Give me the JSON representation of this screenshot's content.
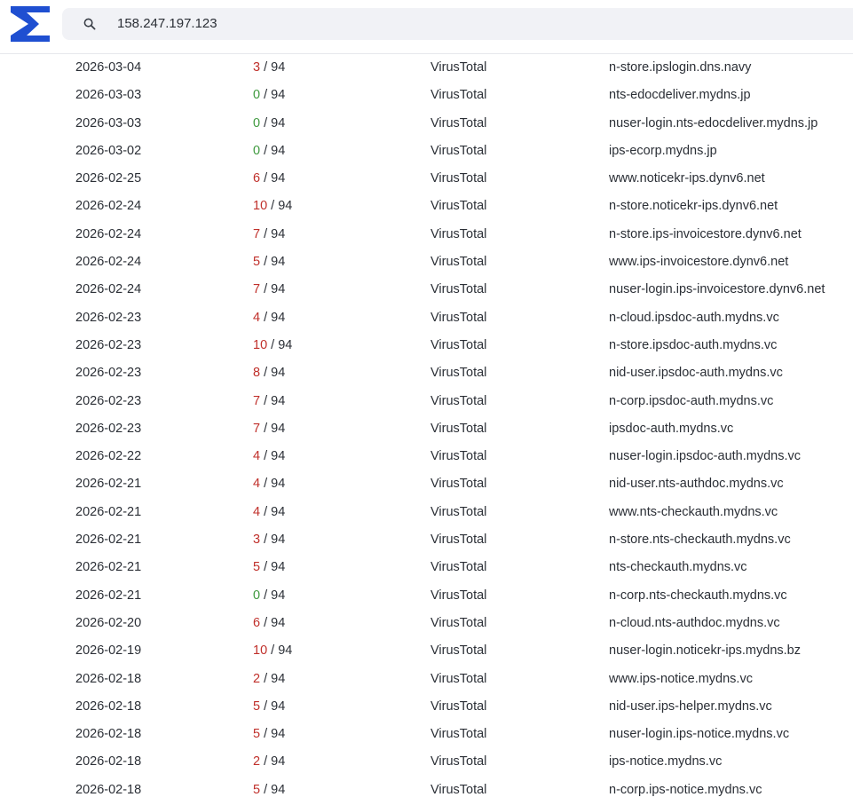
{
  "search": {
    "value": "158.247.197.123"
  },
  "colors": {
    "malicious": "#c0302b",
    "clean": "#3f9a3f",
    "logo": "#1f4fd1"
  },
  "rows": [
    {
      "date": "2026-03-04",
      "positives": "3",
      "total": "/ 94",
      "source": "VirusTotal",
      "domain": "n-store.ipslogin.dns.navy"
    },
    {
      "date": "2026-03-03",
      "positives": "0",
      "total": "/ 94",
      "source": "VirusTotal",
      "domain": "nts-edocdeliver.mydns.jp"
    },
    {
      "date": "2026-03-03",
      "positives": "0",
      "total": "/ 94",
      "source": "VirusTotal",
      "domain": "nuser-login.nts-edocdeliver.mydns.jp"
    },
    {
      "date": "2026-03-02",
      "positives": "0",
      "total": "/ 94",
      "source": "VirusTotal",
      "domain": "ips-ecorp.mydns.jp"
    },
    {
      "date": "2026-02-25",
      "positives": "6",
      "total": "/ 94",
      "source": "VirusTotal",
      "domain": "www.noticekr-ips.dynv6.net"
    },
    {
      "date": "2026-02-24",
      "positives": "10",
      "total": "/ 94",
      "source": "VirusTotal",
      "domain": "n-store.noticekr-ips.dynv6.net"
    },
    {
      "date": "2026-02-24",
      "positives": "7",
      "total": "/ 94",
      "source": "VirusTotal",
      "domain": "n-store.ips-invoicestore.dynv6.net"
    },
    {
      "date": "2026-02-24",
      "positives": "5",
      "total": "/ 94",
      "source": "VirusTotal",
      "domain": "www.ips-invoicestore.dynv6.net"
    },
    {
      "date": "2026-02-24",
      "positives": "7",
      "total": "/ 94",
      "source": "VirusTotal",
      "domain": "nuser-login.ips-invoicestore.dynv6.net"
    },
    {
      "date": "2026-02-23",
      "positives": "4",
      "total": "/ 94",
      "source": "VirusTotal",
      "domain": "n-cloud.ipsdoc-auth.mydns.vc"
    },
    {
      "date": "2026-02-23",
      "positives": "10",
      "total": "/ 94",
      "source": "VirusTotal",
      "domain": "n-store.ipsdoc-auth.mydns.vc"
    },
    {
      "date": "2026-02-23",
      "positives": "8",
      "total": "/ 94",
      "source": "VirusTotal",
      "domain": "nid-user.ipsdoc-auth.mydns.vc"
    },
    {
      "date": "2026-02-23",
      "positives": "7",
      "total": "/ 94",
      "source": "VirusTotal",
      "domain": "n-corp.ipsdoc-auth.mydns.vc"
    },
    {
      "date": "2026-02-23",
      "positives": "7",
      "total": "/ 94",
      "source": "VirusTotal",
      "domain": "ipsdoc-auth.mydns.vc"
    },
    {
      "date": "2026-02-22",
      "positives": "4",
      "total": "/ 94",
      "source": "VirusTotal",
      "domain": "nuser-login.ipsdoc-auth.mydns.vc"
    },
    {
      "date": "2026-02-21",
      "positives": "4",
      "total": "/ 94",
      "source": "VirusTotal",
      "domain": "nid-user.nts-authdoc.mydns.vc"
    },
    {
      "date": "2026-02-21",
      "positives": "4",
      "total": "/ 94",
      "source": "VirusTotal",
      "domain": "www.nts-checkauth.mydns.vc"
    },
    {
      "date": "2026-02-21",
      "positives": "3",
      "total": "/ 94",
      "source": "VirusTotal",
      "domain": "n-store.nts-checkauth.mydns.vc"
    },
    {
      "date": "2026-02-21",
      "positives": "5",
      "total": "/ 94",
      "source": "VirusTotal",
      "domain": "nts-checkauth.mydns.vc"
    },
    {
      "date": "2026-02-21",
      "positives": "0",
      "total": "/ 94",
      "source": "VirusTotal",
      "domain": "n-corp.nts-checkauth.mydns.vc"
    },
    {
      "date": "2026-02-20",
      "positives": "6",
      "total": "/ 94",
      "source": "VirusTotal",
      "domain": "n-cloud.nts-authdoc.mydns.vc"
    },
    {
      "date": "2026-02-19",
      "positives": "10",
      "total": "/ 94",
      "source": "VirusTotal",
      "domain": "nuser-login.noticekr-ips.mydns.bz"
    },
    {
      "date": "2026-02-18",
      "positives": "2",
      "total": "/ 94",
      "source": "VirusTotal",
      "domain": "www.ips-notice.mydns.vc"
    },
    {
      "date": "2026-02-18",
      "positives": "5",
      "total": "/ 94",
      "source": "VirusTotal",
      "domain": "nid-user.ips-helper.mydns.vc"
    },
    {
      "date": "2026-02-18",
      "positives": "5",
      "total": "/ 94",
      "source": "VirusTotal",
      "domain": "nuser-login.ips-notice.mydns.vc"
    },
    {
      "date": "2026-02-18",
      "positives": "2",
      "total": "/ 94",
      "source": "VirusTotal",
      "domain": "ips-notice.mydns.vc"
    },
    {
      "date": "2026-02-18",
      "positives": "5",
      "total": "/ 94",
      "source": "VirusTotal",
      "domain": "n-corp.ips-notice.mydns.vc"
    }
  ]
}
